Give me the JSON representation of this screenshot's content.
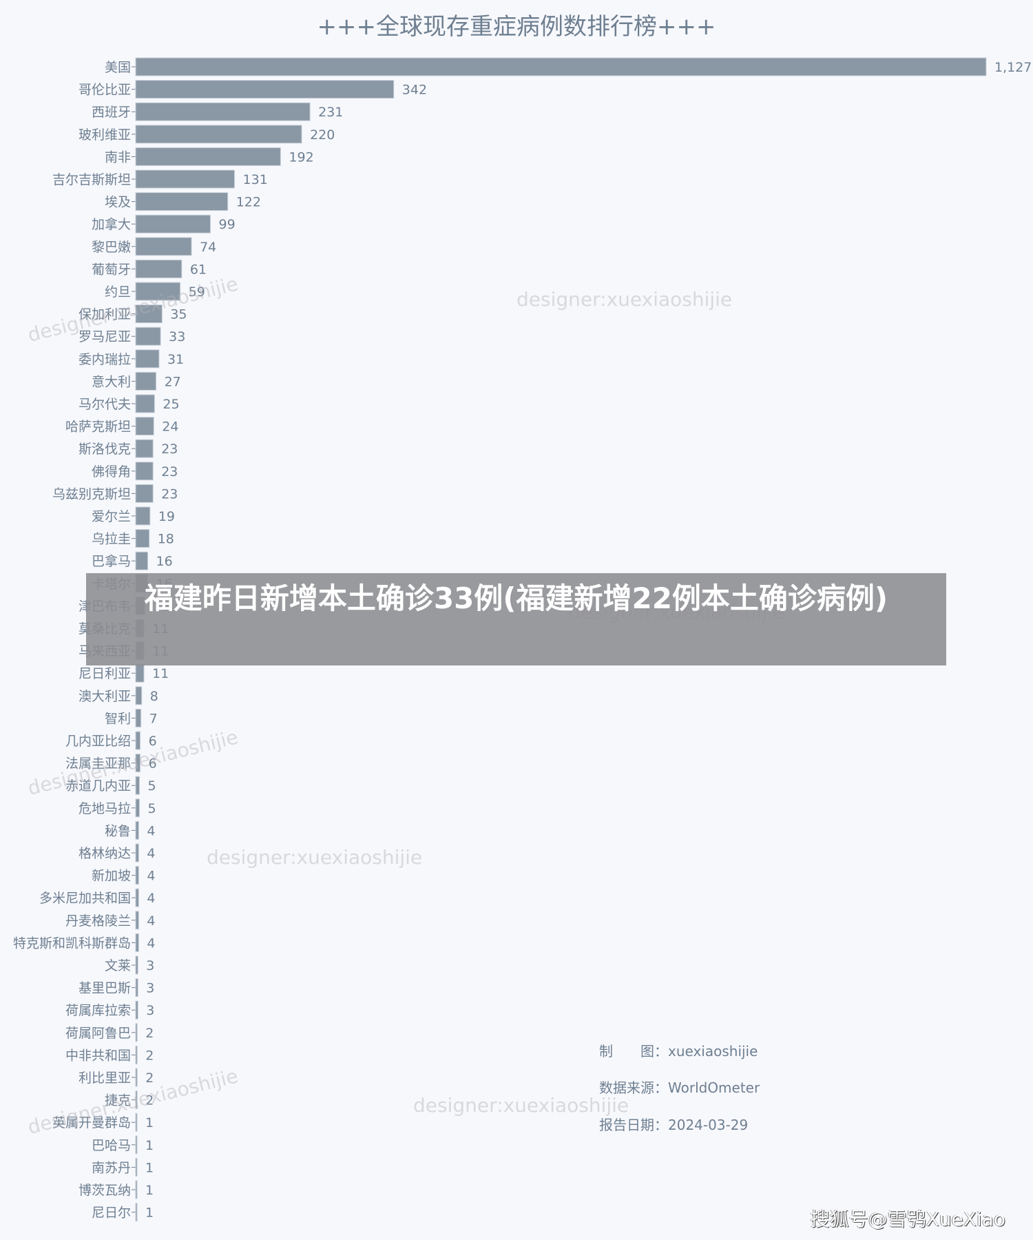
{
  "chart_data": {
    "type": "bar",
    "orientation": "horizontal",
    "title": "+++全球现存重症病例数排行榜+++",
    "xlabel": "",
    "ylabel": "",
    "xlim": [
      0,
      1127
    ],
    "grid": false,
    "legend": "none",
    "categories": [
      "美国",
      "哥伦比亚",
      "西班牙",
      "玻利维亚",
      "南非",
      "吉尔吉斯斯坦",
      "埃及",
      "加拿大",
      "黎巴嫩",
      "葡萄牙",
      "约旦",
      "保加利亚",
      "罗马尼亚",
      "委内瑞拉",
      "意大利",
      "马尔代夫",
      "哈萨克斯坦",
      "斯洛伐克",
      "佛得角",
      "乌兹别克斯坦",
      "爱尔兰",
      "乌拉圭",
      "巴拿马",
      "卡塔尔",
      "津巴布韦",
      "莫桑比克",
      "马来西亚",
      "尼日利亚",
      "澳大利亚",
      "智利",
      "几内亚比绍",
      "法属圭亚那",
      "赤道几内亚",
      "危地马拉",
      "秘鲁",
      "格林纳达",
      "新加坡",
      "多米尼加共和国",
      "丹麦格陵兰",
      "特克斯和凯科斯群岛",
      "文莱",
      "基里巴斯",
      "荷属库拉索",
      "荷属阿鲁巴",
      "中非共和国",
      "利比里亚",
      "捷克",
      "英属开曼群岛",
      "巴哈马",
      "南苏丹",
      "博茨瓦纳",
      "尼日尔"
    ],
    "values": [
      1127,
      342,
      231,
      220,
      192,
      131,
      122,
      99,
      74,
      61,
      59,
      35,
      33,
      31,
      27,
      25,
      24,
      23,
      23,
      23,
      19,
      18,
      16,
      16,
      12,
      11,
      11,
      11,
      8,
      7,
      6,
      6,
      5,
      5,
      4,
      4,
      4,
      4,
      4,
      4,
      3,
      3,
      3,
      2,
      2,
      2,
      2,
      1,
      1,
      1,
      1,
      1
    ],
    "value_labels": [
      "1,127",
      "342",
      "231",
      "220",
      "192",
      "131",
      "122",
      "99",
      "74",
      "61",
      "59",
      "35",
      "33",
      "31",
      "27",
      "25",
      "24",
      "23",
      "23",
      "23",
      "19",
      "18",
      "16",
      "16",
      "12",
      "11",
      "11",
      "11",
      "8",
      "7",
      "6",
      "6",
      "5",
      "5",
      "4",
      "4",
      "4",
      "4",
      "4",
      "4",
      "3",
      "3",
      "3",
      "2",
      "2",
      "2",
      "2",
      "1",
      "1",
      "1",
      "1",
      "1"
    ],
    "colors": {
      "bar": "#8a98a5",
      "text": "#6e7f91",
      "background": "#f7f8fc"
    }
  },
  "watermark": "designer:xuexiaoshijie",
  "info": {
    "maker_label": "制　　图：",
    "maker_value": "xuexiaoshijie",
    "source_label": "数据来源：",
    "source_value": "WorldOmeter",
    "date_label": "报告日期：",
    "date_value": "2024-03-29"
  },
  "overlay": {
    "headline": "福建昨日新增本土确诊33例(福建新增22例本土确诊病例)"
  },
  "footer": {
    "credit": "搜狐号@雪鸮XueXiao"
  }
}
